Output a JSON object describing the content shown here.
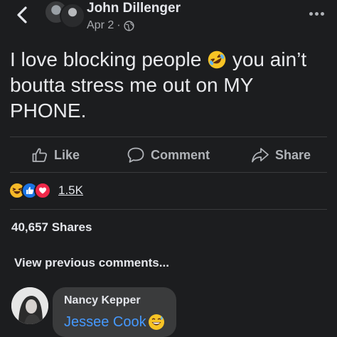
{
  "header": {
    "back_icon": "chevron-left-icon",
    "author_name": "John Dillenger",
    "timestamp": "Apr 2",
    "separator": "·",
    "audience_icon": "globe-icon",
    "more_icon": "more-horizontal-icon"
  },
  "post": {
    "text_before_emoji": "I love blocking people ",
    "emoji": "rolling-on-floor-laughing-emoji",
    "text_after_emoji": " you ain’t boutta stress me out on MY PHONE."
  },
  "actions": {
    "like_label": "Like",
    "comment_label": "Comment",
    "share_label": "Share"
  },
  "reactions": {
    "icons": [
      "haha-reaction-icon",
      "like-reaction-icon",
      "love-reaction-icon"
    ],
    "count": "1.5K"
  },
  "shares": "40,657 Shares",
  "comments": {
    "view_previous_label": "View previous comments...",
    "items": [
      {
        "author": "Nancy Kepper",
        "text": "Jessee Cook",
        "emoji": "grinning-sweat-emoji"
      }
    ]
  },
  "colors": {
    "background": "#1c1d1f",
    "text_primary": "#e4e6eb",
    "text_secondary": "#b0b3b8",
    "link_blue": "#4599ff",
    "bubble": "#3a3b3c",
    "like_blue": "#1b74e4",
    "love_red": "#f02849",
    "haha_yellow": "#f7b928"
  }
}
